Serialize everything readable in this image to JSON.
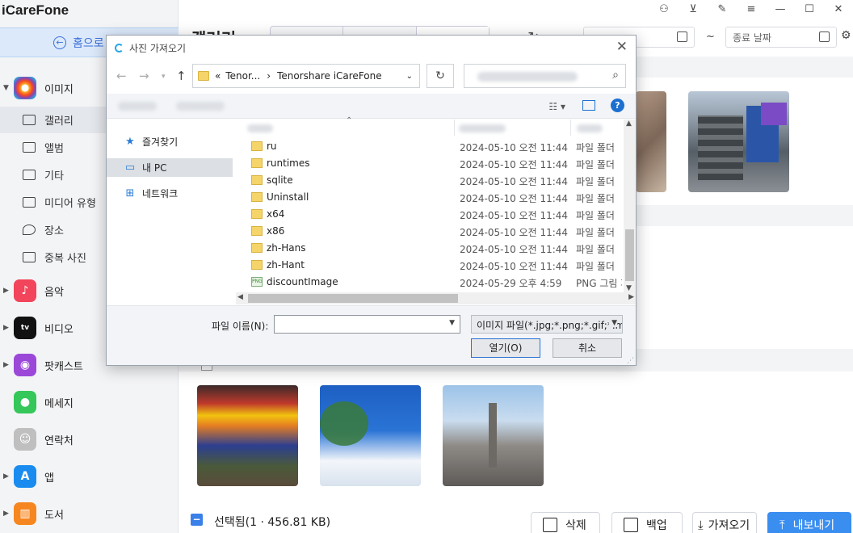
{
  "app": {
    "title": "iCareFone",
    "home_label": "홈으로"
  },
  "window_controls": [
    "user-icon",
    "download-icon",
    "edit-icon",
    "menu-icon",
    "minimize-icon",
    "maximize-icon",
    "close-icon"
  ],
  "sidebar": {
    "categories": [
      {
        "label": "이미지",
        "icon": "photos-icon",
        "color": "#f39c12"
      },
      {
        "label": "음악",
        "icon": "music-icon",
        "color": "#f2445a"
      },
      {
        "label": "비디오",
        "icon": "appletv-icon",
        "color": "#111111"
      },
      {
        "label": "팟캐스트",
        "icon": "podcast-icon",
        "color": "#9b48d9"
      },
      {
        "label": "메세지",
        "icon": "message-icon",
        "color": "#35c759"
      },
      {
        "label": "연락처",
        "icon": "contacts-icon",
        "color": "#bfbfbf"
      },
      {
        "label": "앱",
        "icon": "appstore-icon",
        "color": "#1a8cf0"
      },
      {
        "label": "도서",
        "icon": "books-icon",
        "color": "#f6861f"
      }
    ],
    "image_subitems": [
      {
        "label": "갤러리",
        "icon": "gallery-icon"
      },
      {
        "label": "앨범",
        "icon": "album-icon"
      },
      {
        "label": "기타",
        "icon": "other-icon"
      },
      {
        "label": "미디어 유형",
        "icon": "media-type-icon"
      },
      {
        "label": "장소",
        "icon": "place-icon"
      },
      {
        "label": "중복 사진",
        "icon": "duplicate-icon"
      }
    ]
  },
  "main": {
    "title": "갤러리",
    "end_date_placeholder": "종료 날짜",
    "tilde": "~",
    "selection": {
      "text": "선택됨(1 · 456.81 KB)",
      "checkmark": "−"
    },
    "actions": {
      "delete": "삭제",
      "backup": "백업",
      "import": "가져오기",
      "export": "내보내기"
    }
  },
  "dialog": {
    "title": "사진 가져오기",
    "breadcrumb": {
      "prefix": "«",
      "part1": "Tenor...",
      "sep": "›",
      "part2": "Tenorshare iCareFone"
    },
    "nav": [
      {
        "label": "즐겨찾기",
        "icon": "star-icon"
      },
      {
        "label": "내 PC",
        "icon": "pc-icon"
      },
      {
        "label": "네트워크",
        "icon": "network-icon"
      }
    ],
    "files": [
      {
        "name": "ru",
        "date": "2024-05-10 오전 11:44",
        "type": "파일 폴더"
      },
      {
        "name": "runtimes",
        "date": "2024-05-10 오전 11:44",
        "type": "파일 폴더"
      },
      {
        "name": "sqlite",
        "date": "2024-05-10 오전 11:44",
        "type": "파일 폴더"
      },
      {
        "name": "Uninstall",
        "date": "2024-05-10 오전 11:44",
        "type": "파일 폴더"
      },
      {
        "name": "x64",
        "date": "2024-05-10 오전 11:44",
        "type": "파일 폴더"
      },
      {
        "name": "x86",
        "date": "2024-05-10 오전 11:44",
        "type": "파일 폴더"
      },
      {
        "name": "zh-Hans",
        "date": "2024-05-10 오전 11:44",
        "type": "파일 폴더"
      },
      {
        "name": "zh-Hant",
        "date": "2024-05-10 오전 11:44",
        "type": "파일 폴더"
      },
      {
        "name": "discountImage",
        "date": "2024-05-29 오후 4:59",
        "type": "PNG 그림 파일"
      }
    ],
    "filename_label": "파일 이름(N):",
    "filename_value": "",
    "filter": "이미지 파일(*.jpg;*.png;*.gif;*.m",
    "open_button": "열기(O)",
    "cancel_button": "취소",
    "help": "?"
  }
}
